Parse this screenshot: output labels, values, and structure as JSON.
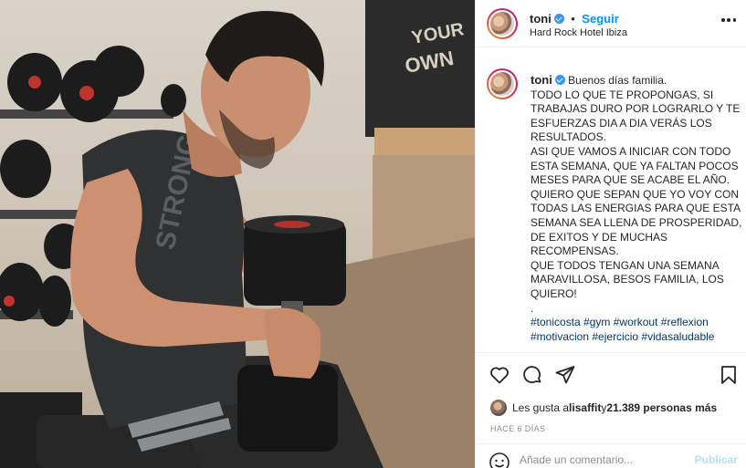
{
  "post": {
    "image_alt": "Hombre entrenando con mancuerna en gimnasio",
    "shirt_text": "STRONG"
  },
  "header": {
    "username": "toni",
    "separator": "•",
    "follow_label": "Seguir",
    "location": "Hard Rock Hotel Ibiza"
  },
  "caption": {
    "username": "toni",
    "lines": [
      "Buenos días familia.",
      "TODO LO QUE TE PROPONGAS, SI",
      "TRABAJAS DURO POR LOGRARLO Y TE",
      "ESFUERZAS DIA A DIA VERÁS LOS",
      "RESULTADOS.",
      "ASI QUE VAMOS A INICIAR CON TODO",
      "ESTA SEMANA, QUE YA FALTAN POCOS",
      "MESES PARA QUE SE ACABE EL AÑO.",
      "QUIERO QUE SEPAN QUE YO VOY CON",
      "TODAS LAS ENERGIAS PARA QUE ESTA",
      "SEMANA SEA LLENA DE PROSPERIDAD,",
      "DE EXITOS Y DE MUCHAS",
      "RECOMPENSAS.",
      "QUE TODOS TENGAN UNA SEMANA",
      "MARAVILLOSA, BESOS FAMILIA, LOS",
      "QUIERO!",
      "."
    ],
    "hashtags_line1": [
      "#tonicosta",
      "#gym",
      "#workout",
      "#reflexion"
    ],
    "hashtags_line2": [
      "#motivacion",
      "#ejercicio",
      "#vidasaludable"
    ]
  },
  "actions": {
    "icons": [
      "heart-icon",
      "comment-icon",
      "share-icon",
      "bookmark-icon"
    ]
  },
  "likes": {
    "prefix": "Les gusta a ",
    "first_user": "lisaffit",
    "middle": " y ",
    "others": "21.389 personas más"
  },
  "timestamp": "HACE 6 DÍAS",
  "comment": {
    "placeholder": "Añade un comentario...",
    "publish_label": "Publicar"
  }
}
